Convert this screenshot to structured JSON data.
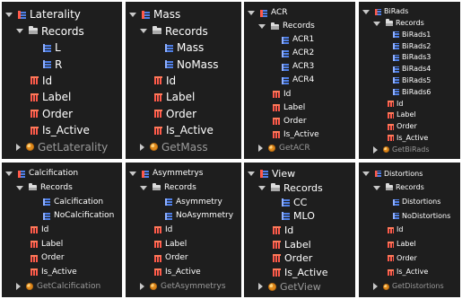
{
  "panels": [
    {
      "id": "laterality",
      "root": "Laterality",
      "records_label": "Records",
      "records": [
        "L",
        "R"
      ],
      "fields": [
        "Id",
        "Label",
        "Order",
        "Is_Active"
      ],
      "method": "GetLaterality"
    },
    {
      "id": "mass",
      "root": "Mass",
      "records_label": "Records",
      "records": [
        "Mass",
        "NoMass"
      ],
      "fields": [
        "Id",
        "Label",
        "Order",
        "Is_Active"
      ],
      "method": "GetMass"
    },
    {
      "id": "acr",
      "root": "ACR",
      "records_label": "Records",
      "records": [
        "ACR1",
        "ACR2",
        "ACR3",
        "ACR4"
      ],
      "fields": [
        "Id",
        "Label",
        "Order",
        "Is_Active"
      ],
      "method": "GetACR"
    },
    {
      "id": "birads",
      "root": "BiRads",
      "records_label": "Records",
      "records": [
        "BiRads1",
        "BiRads2",
        "BiRads3",
        "BiRads4",
        "BiRads5",
        "BiRads6"
      ],
      "fields": [
        "Id",
        "Label",
        "Order",
        "Is_Active"
      ],
      "method": "GetBiRads"
    },
    {
      "id": "calcification",
      "root": "Calcification",
      "records_label": "Records",
      "records": [
        "Calcification",
        "NoCalcification"
      ],
      "fields": [
        "Id",
        "Label",
        "Order",
        "Is_Active"
      ],
      "method": "GetCalcification"
    },
    {
      "id": "asymmetrys",
      "root": "Asymmetrys",
      "records_label": "Records",
      "records": [
        "Asymmetry",
        "NoAsymmetry"
      ],
      "fields": [
        "Id",
        "Label",
        "Order",
        "Is_Active"
      ],
      "method": "GetAsymmetrys"
    },
    {
      "id": "view",
      "root": "View",
      "records_label": "Records",
      "records": [
        "CC",
        "MLO"
      ],
      "fields": [
        "Id",
        "Label",
        "Order",
        "Is_Active"
      ],
      "method": "GetView"
    },
    {
      "id": "distortions",
      "root": "Distortions",
      "records_label": "Records",
      "records": [
        "Distortions",
        "NoDistortions"
      ],
      "fields": [
        "Id",
        "Label",
        "Order",
        "Is_Active"
      ],
      "method": "GetDistortions"
    }
  ],
  "icons": {
    "expanded": "expanded-triangle-icon",
    "collapsed": "collapsed-triangle-icon",
    "table": "table-icon",
    "folder": "folder-icon",
    "record": "record-grid-icon",
    "field": "field-grid-icon",
    "method": "method-orb-icon"
  },
  "colors": {
    "panel_bg": "#1e1e1e",
    "text": "#ffffff",
    "muted_text": "#9a9a9a",
    "field_red": "#ff5a4a",
    "record_blue": "#4f7fe6",
    "method_orange": "#e08a1c"
  }
}
